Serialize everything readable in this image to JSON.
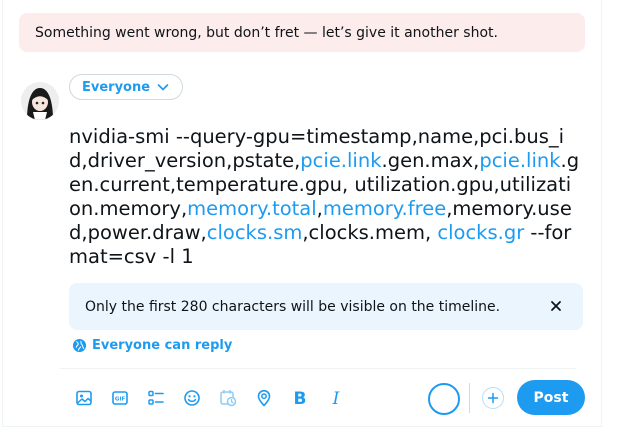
{
  "error": {
    "message": "Something went wrong, but don’t fret — let’s give it another shot."
  },
  "audience": {
    "label": "Everyone"
  },
  "compose": {
    "segments": [
      {
        "text": "nvidia-smi --query-gpu=timestamp,name,pci.bus_id,driver_version,pstate,",
        "link": false
      },
      {
        "text": "pcie.link",
        "link": true
      },
      {
        "text": ".gen.max,",
        "link": false
      },
      {
        "text": "pcie.link",
        "link": true
      },
      {
        "text": ".gen.current,temperature.gpu, utilization.gpu,utilization.memory,",
        "link": false
      },
      {
        "text": "memory.total",
        "link": true
      },
      {
        "text": ",",
        "link": false
      },
      {
        "text": "memory.free",
        "link": true
      },
      {
        "text": ",memory.used,power.draw,",
        "link": false
      },
      {
        "text": "clocks.sm",
        "link": true
      },
      {
        "text": ",clocks.mem, ",
        "link": false
      },
      {
        "text": "clocks.gr",
        "link": true
      },
      {
        "text": " --format=csv -l 1",
        "link": false
      }
    ]
  },
  "notice": {
    "message": "Only the first 280 characters will be visible on the timeline."
  },
  "reply": {
    "label": "Everyone can reply"
  },
  "toolbar": {
    "icons": [
      "image-icon",
      "gif-icon",
      "poll-icon",
      "emoji-icon",
      "schedule-icon",
      "location-icon",
      "bold-icon",
      "italic-icon"
    ],
    "gif_label": "GIF",
    "bold_label": "B",
    "italic_label": "I"
  },
  "post": {
    "label": "Post"
  },
  "colors": {
    "accent": "#1d9bf0",
    "error_bg": "#fcecec",
    "notice_bg": "#eaf5fd"
  }
}
